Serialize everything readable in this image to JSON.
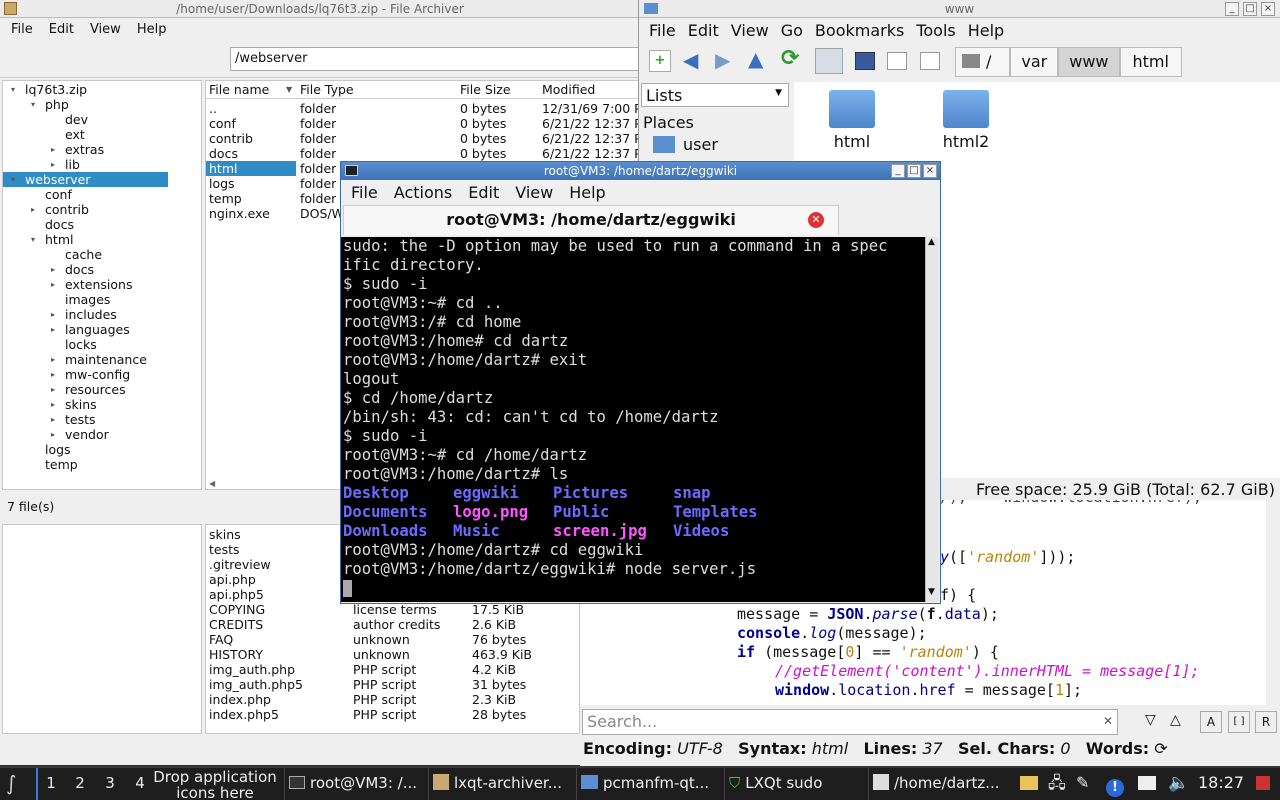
{
  "archiver": {
    "title": "/home/user/Downloads/lq76t3.zip - File Archiver",
    "menu": [
      "File",
      "Edit",
      "View",
      "Help"
    ],
    "path": "/webserver",
    "tree": [
      {
        "label": "lq76t3.zip",
        "arrow": "▾"
      },
      {
        "label": "php",
        "arrow": "▾"
      },
      {
        "label": "dev",
        "arrow": ""
      },
      {
        "label": "ext",
        "arrow": ""
      },
      {
        "label": "extras",
        "arrow": "▸"
      },
      {
        "label": "lib",
        "arrow": "▸"
      },
      {
        "label": "webserver",
        "arrow": "▾"
      },
      {
        "label": "conf",
        "arrow": ""
      },
      {
        "label": "contrib",
        "arrow": "▸"
      },
      {
        "label": "docs",
        "arrow": ""
      },
      {
        "label": "html",
        "arrow": "▾"
      },
      {
        "label": "cache",
        "arrow": ""
      },
      {
        "label": "docs",
        "arrow": "▸"
      },
      {
        "label": "extensions",
        "arrow": "▸"
      },
      {
        "label": "images",
        "arrow": ""
      },
      {
        "label": "includes",
        "arrow": "▸"
      },
      {
        "label": "languages",
        "arrow": "▸"
      },
      {
        "label": "locks",
        "arrow": ""
      },
      {
        "label": "maintenance",
        "arrow": "▸"
      },
      {
        "label": "mw-config",
        "arrow": "▸"
      },
      {
        "label": "resources",
        "arrow": "▸"
      },
      {
        "label": "skins",
        "arrow": "▸"
      },
      {
        "label": "tests",
        "arrow": "▸"
      },
      {
        "label": "vendor",
        "arrow": "▸"
      },
      {
        "label": "logs",
        "arrow": ""
      },
      {
        "label": "temp",
        "arrow": ""
      }
    ],
    "columns": [
      "File name",
      "File Type",
      "File Size",
      "Modified"
    ],
    "rows": [
      [
        "..",
        "folder",
        "0 bytes",
        "12/31/69 7:00 P"
      ],
      [
        "conf",
        "folder",
        "0 bytes",
        "6/21/22 12:37 P"
      ],
      [
        "contrib",
        "folder",
        "0 bytes",
        "6/21/22 12:37 P"
      ],
      [
        "docs",
        "folder",
        "0 bytes",
        "6/21/22 12:37 P"
      ],
      [
        "html",
        "folder",
        "",
        ""
      ],
      [
        "logs",
        "folder",
        "",
        ""
      ],
      [
        "temp",
        "folder",
        "",
        ""
      ],
      [
        "nginx.exe",
        "DOS/W",
        "",
        ""
      ]
    ],
    "status": "7 file(s)"
  },
  "archiver2": {
    "rows": [
      [
        "skins",
        "",
        ""
      ],
      [
        "tests",
        "",
        ""
      ],
      [
        ".gitreview",
        "",
        ""
      ],
      [
        "api.php",
        "",
        ""
      ],
      [
        "api.php5",
        "",
        ""
      ],
      [
        "COPYING",
        "license terms",
        "17.5 KiB"
      ],
      [
        "CREDITS",
        "author credits",
        "2.6 KiB"
      ],
      [
        "FAQ",
        "unknown",
        "76 bytes"
      ],
      [
        "HISTORY",
        "unknown",
        "463.9 KiB"
      ],
      [
        "img_auth.php",
        "PHP script",
        "4.2 KiB"
      ],
      [
        "img_auth.php5",
        "PHP script",
        "31 bytes"
      ],
      [
        "index.php",
        "PHP script",
        "2.3 KiB"
      ],
      [
        "index.php5",
        "PHP script",
        "28 bytes"
      ]
    ]
  },
  "filemanager": {
    "title": "www",
    "menu": [
      "File",
      "Edit",
      "View",
      "Go",
      "Bookmarks",
      "Tools",
      "Help"
    ],
    "crumbs": [
      "/",
      "var",
      "www",
      "html"
    ],
    "side_dropdown": "Lists",
    "places_header": "Places",
    "places": [
      "user"
    ],
    "items": [
      "html",
      "html2"
    ],
    "status": "Free space: 25.9 GiB (Total: 62.7 GiB)"
  },
  "terminal": {
    "title": "root@VM3: /home/dartz/eggwiki",
    "menu": [
      "File",
      "Actions",
      "Edit",
      "View",
      "Help"
    ],
    "tab": "root@VM3: /home/dartz/eggwiki",
    "lines": [
      "sudo: the -D option may be used to run a command in a spec",
      "ific directory.",
      "$ sudo -i",
      "root@VM3:~# cd ..",
      "root@VM3:/# cd home",
      "root@VM3:/home# cd dartz",
      "root@VM3:/home/dartz# exit",
      "logout",
      "$ cd /home/dartz",
      "/bin/sh: 43: cd: can't cd to /home/dartz",
      "$ sudo -i",
      "root@VM3:~# cd /home/dartz",
      "root@VM3:/home/dartz# ls"
    ],
    "ls": [
      [
        "Desktop",
        "eggwiki",
        "Pictures",
        "snap"
      ],
      [
        "Documents",
        "logo.png",
        "Public",
        "Templates"
      ],
      [
        "Downloads",
        "Music",
        "screen.jpg",
        "Videos"
      ]
    ],
    "after": [
      "root@VM3:/home/dartz# cd eggwiki",
      "root@VM3:/home/dartz/eggwiki# node server.js"
    ]
  },
  "editor": {
    "search_placeholder": "Search...",
    "encoding_label": "Encoding:",
    "encoding": "UTF-8",
    "syntax_label": "Syntax:",
    "syntax": "html",
    "lines_label": "Lines:",
    "lines": "37",
    "sel_label": "Sel. Chars:",
    "sel": "0",
    "words_label": "Words:"
  },
  "taskbar": {
    "desktops": [
      "1",
      "2",
      "3",
      "4"
    ],
    "drop": "Drop application icons here",
    "tasks": [
      "root@VM3: /...",
      "lxqt-archiver...",
      "pcmanfm-qt...",
      "LXQt sudo",
      "/home/dartz..."
    ],
    "clock": "18:27"
  },
  "colors": {
    "selection": "#308cc6",
    "term_bg": "#000000",
    "ls_dir": "#6b6bff",
    "ls_img": "#ff55ff",
    "keyword": "#00008b",
    "string": "#b8860b",
    "comment": "#d010d0"
  }
}
